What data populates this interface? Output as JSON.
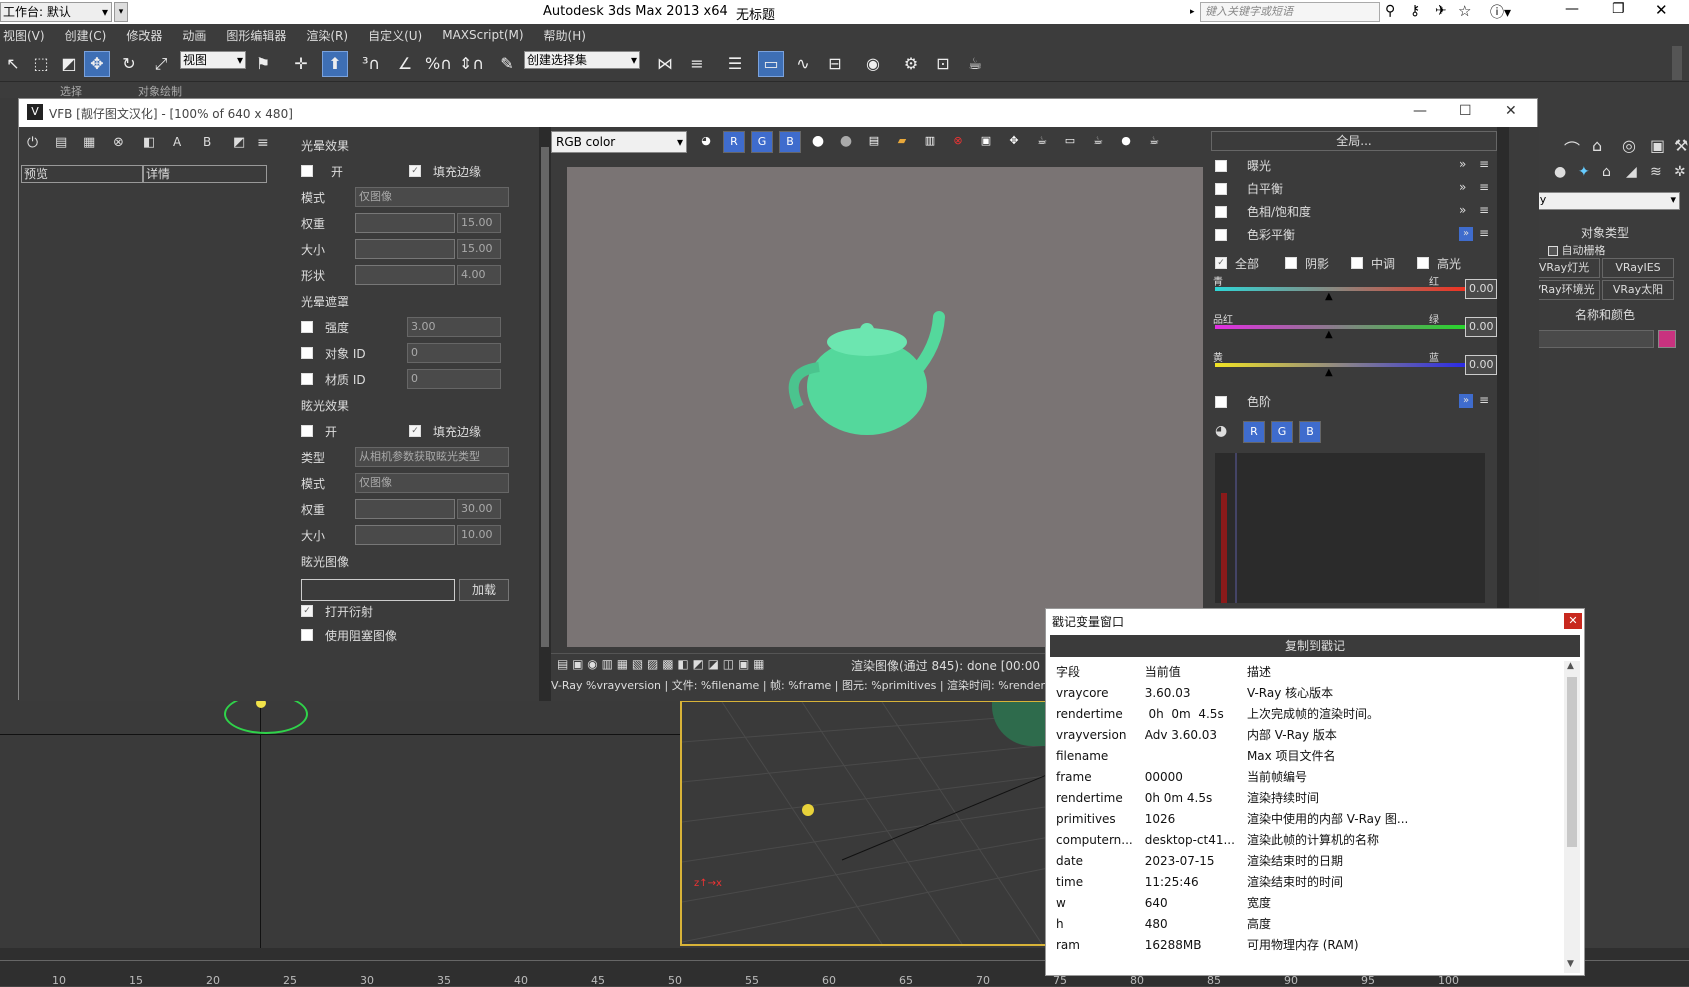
{
  "titlebar": {
    "workspace": "工作台: 默认",
    "app_title": "Autodesk 3ds Max  2013 x64",
    "file_title": "无标题",
    "search_placeholder": "键入关键字或短语"
  },
  "menu": [
    "视图(V)",
    "创建(C)",
    "修改器",
    "动画",
    "图形编辑器",
    "渲染(R)",
    "自定义(U)",
    "MAXScript(M)",
    "帮助(H)"
  ],
  "toolbar": {
    "view_dropdown": "视图",
    "selection_set": "创建选择集"
  },
  "subbar": {
    "a": "选择",
    "b": "对象绘制"
  },
  "vfb": {
    "title": "VFB [靓仔图文汉化] - [100% of 640 x 480]",
    "tabs": {
      "preview": "预览",
      "details": "详情"
    },
    "lens": {
      "glare_title": "光晕效果",
      "on": "开",
      "fill_edges": "填充边缘",
      "mode": "模式",
      "mode_val": "仅图像",
      "weight": "权重",
      "weight_val": "15.00",
      "size": "大小",
      "size_val": "15.00",
      "shape": "形状",
      "shape_val": "4.00",
      "mask_title": "光晕遮罩",
      "intensity": "强度",
      "intensity_val": "3.00",
      "object_id": "对象 ID",
      "object_id_val": "0",
      "material_id": "材质 ID",
      "material_id_val": "0",
      "bloom_title": "眩光效果",
      "bloom_on": "开",
      "bloom_fill": "填充边缘",
      "type": "类型",
      "type_val": "从相机参数获取眩光类型",
      "bloom_mode": "模式",
      "bloom_mode_val": "仅图像",
      "bloom_weight": "权重",
      "bloom_weight_val": "30.00",
      "bloom_size": "大小",
      "bloom_size_val": "10.00",
      "bloom_image": "眩光图像",
      "load": "加载",
      "diffraction": "打开衍射",
      "obstacle": "使用阻塞图像"
    },
    "channel": "RGB color",
    "status": "渲染图像(通过 845): done [00:00",
    "stamp_line": "V-Ray %vrayversion | 文件: %filename | 帧: %frame | 图元: %primitives | 渲染时间: %rendertime",
    "corrections": {
      "global_btn": "全局...",
      "exposure": "曝光",
      "white_balance": "白平衡",
      "hue_sat": "色相/饱和度",
      "color_balance": "色彩平衡",
      "all": "全部",
      "shadows": "阴影",
      "midtones": "中调",
      "highlights": "高光",
      "cyan": "青",
      "red": "红",
      "magenta": "品红",
      "green": "绿",
      "yellow": "黄",
      "blue": "蓝",
      "cr_val": "0.00",
      "mg_val": "0.00",
      "yb_val": "0.00",
      "levels": "色阶"
    }
  },
  "right_panel": {
    "dropdown": "ay",
    "object_type": "对象类型",
    "auto_grid": "自动栅格",
    "btn1": "VRay灯光",
    "btn2": "VRayIES",
    "btn3": "VRay环境光",
    "btn4": "VRay太阳",
    "name_color": "名称和颜色"
  },
  "stamp_window": {
    "title": "戳记变量窗口",
    "copy_btn": "复制到戳记",
    "headers": [
      "字段",
      "当前值",
      "描述"
    ],
    "rows": [
      [
        "vraycore",
        "3.60.03",
        "V-Ray 核心版本"
      ],
      [
        "rendertime",
        " 0h  0m  4.5s",
        "上次完成帧的渲染时间。"
      ],
      [
        "vrayversion",
        "Adv 3.60.03",
        "内部 V-Ray 版本"
      ],
      [
        "filename",
        "",
        "Max 项目文件名"
      ],
      [
        "frame",
        "00000",
        "当前帧编号"
      ],
      [
        "rendertime",
        "0h 0m 4.5s",
        "渲染持续时间"
      ],
      [
        "primitives",
        "1026",
        "渲染中使用的内部 V-Ray 图..."
      ],
      [
        "computern...",
        "desktop-ct41...",
        "渲染此帧的计算机的名称"
      ],
      [
        "date",
        "2023-07-15",
        "渲染结束时的日期"
      ],
      [
        "time",
        "11:25:46",
        "渲染结束时的时间"
      ],
      [
        "w",
        "640",
        "宽度"
      ],
      [
        "h",
        "480",
        "高度"
      ],
      [
        "ram",
        "16288MB",
        "可用物理内存 (RAM)"
      ]
    ]
  },
  "timeline": [
    "10",
    "15",
    "20",
    "25",
    "30",
    "35",
    "40",
    "45",
    "50",
    "55",
    "60",
    "65",
    "70",
    "75",
    "80",
    "85",
    "90",
    "95",
    "100"
  ]
}
